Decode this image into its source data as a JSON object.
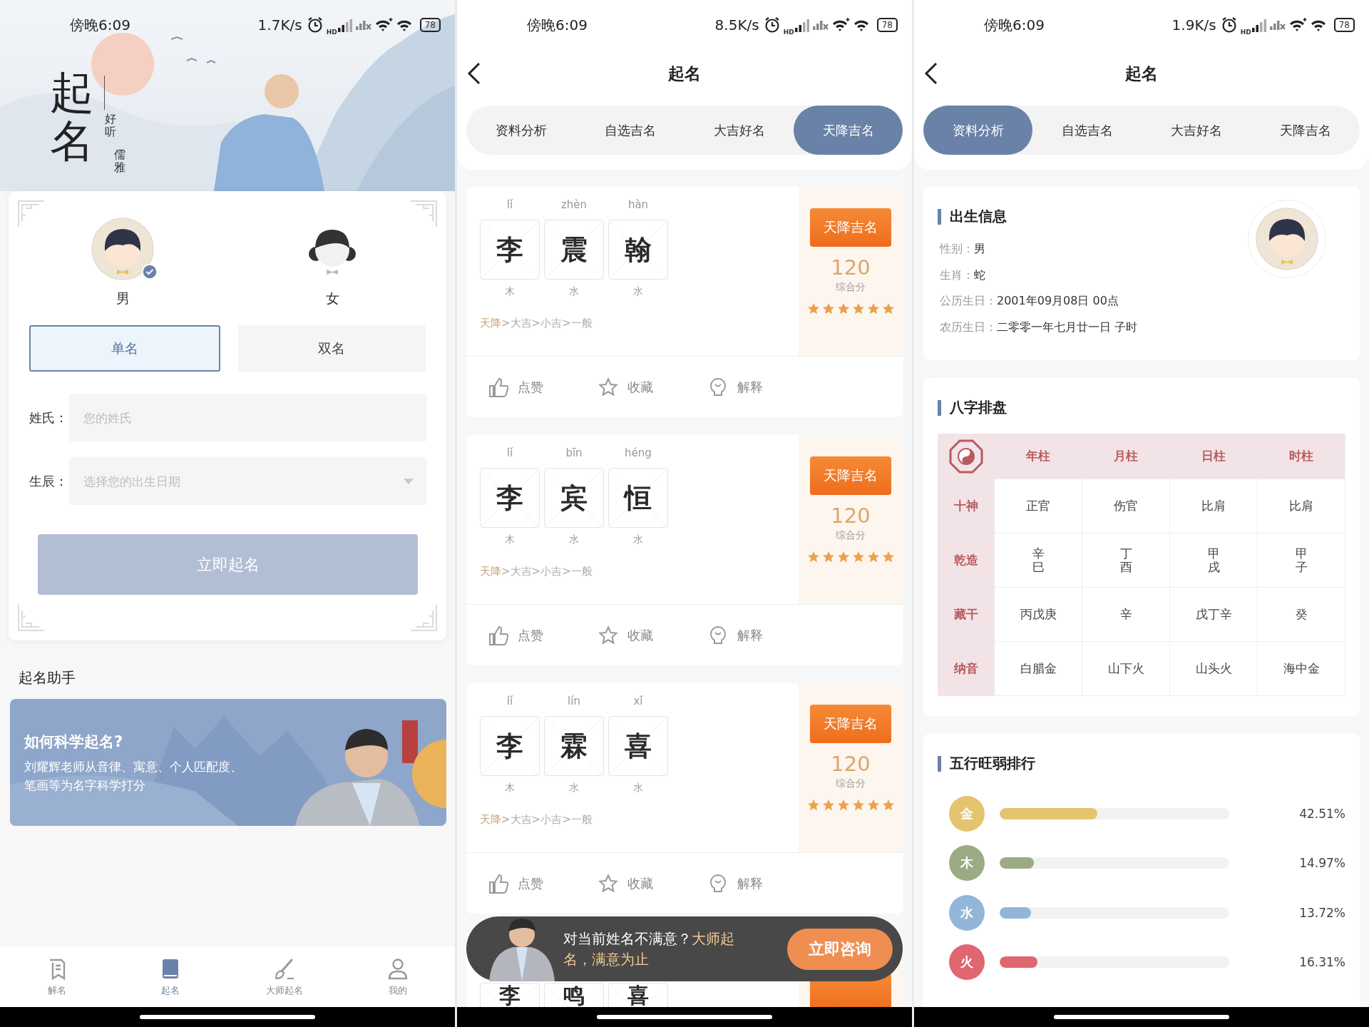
{
  "screens": [
    {
      "kind": "form",
      "status_bar": {
        "time": "傍晚6:09",
        "speed": "1.7K/s",
        "network": "HD",
        "battery": "78"
      },
      "hero": {
        "kind": "picture",
        "title": "起名",
        "taglines": [
          "好听",
          "儒雅"
        ]
      },
      "gender_options": [
        {
          "kind": "boy",
          "label": "男",
          "selected": true
        },
        {
          "kind": "girl",
          "label": "女",
          "selected": false
        }
      ],
      "name_types": [
        {
          "label": "单名",
          "selected": true
        },
        {
          "label": "双名",
          "selected": false
        }
      ],
      "fields": [
        {
          "kind": "text",
          "label": "姓氏：",
          "placeholder": "您的姓氏"
        },
        {
          "kind": "select",
          "label": "生辰：",
          "placeholder": "选择您的出生日期"
        }
      ],
      "submit": "立即起名",
      "section_title": "起名助手",
      "banner": {
        "title": "如何科学起名?",
        "text": "刘耀辉老师从音律、寓意、个人匹配度、笔画等为名字科学打分"
      },
      "tab_bar": [
        {
          "kind": "doc",
          "label": "解名",
          "selected": false
        },
        {
          "kind": "book",
          "label": "起名",
          "selected": true
        },
        {
          "kind": "brush",
          "label": "大师起名",
          "selected": false
        },
        {
          "kind": "person",
          "label": "我的",
          "selected": false
        }
      ]
    },
    {
      "kind": "names",
      "status_bar": {
        "time": "傍晚6:09",
        "speed": "8.5K/s",
        "network": "HD",
        "battery": "78"
      },
      "title": "起名",
      "tabs": [
        {
          "label": "资料分析",
          "selected": false
        },
        {
          "label": "自选吉名",
          "selected": false
        },
        {
          "label": "大吉好名",
          "selected": false
        },
        {
          "label": "天降吉名",
          "selected": true
        }
      ],
      "cards": [
        {
          "kind": "full",
          "chars": [
            {
              "pinyin": "lǐ",
              "char": "李",
              "element": "木"
            },
            {
              "pinyin": "zhèn",
              "char": "震",
              "element": "水"
            },
            {
              "pinyin": "hàn",
              "char": "翰",
              "element": "水"
            }
          ],
          "ranking_current": "天降",
          "ranking_rest": ">大吉>小吉>一般",
          "badge": "天降吉名",
          "score": "120",
          "score_label": "综合分",
          "stars": 6,
          "actions": [
            {
              "kind": "like",
              "label": "点赞"
            },
            {
              "kind": "star",
              "label": "收藏"
            },
            {
              "kind": "bulb",
              "label": "解释"
            }
          ]
        },
        {
          "kind": "full",
          "chars": [
            {
              "pinyin": "lǐ",
              "char": "李",
              "element": "木"
            },
            {
              "pinyin": "bīn",
              "char": "宾",
              "element": "水"
            },
            {
              "pinyin": "héng",
              "char": "恒",
              "element": "水"
            }
          ],
          "ranking_current": "天降",
          "ranking_rest": ">大吉>小吉>一般",
          "badge": "天降吉名",
          "score": "120",
          "score_label": "综合分",
          "stars": 6,
          "actions": [
            {
              "kind": "like",
              "label": "点赞"
            },
            {
              "kind": "star",
              "label": "收藏"
            },
            {
              "kind": "bulb",
              "label": "解释"
            }
          ]
        },
        {
          "kind": "full",
          "chars": [
            {
              "pinyin": "lǐ",
              "char": "李",
              "element": "木"
            },
            {
              "pinyin": "lín",
              "char": "霖",
              "element": "水"
            },
            {
              "pinyin": "xǐ",
              "char": "喜",
              "element": "水"
            }
          ],
          "ranking_current": "天降",
          "ranking_rest": ">大吉>小吉>一般",
          "badge": "天降吉名",
          "score": "120",
          "score_label": "综合分",
          "stars": 6,
          "actions": [
            {
              "kind": "like",
              "label": "点赞"
            },
            {
              "kind": "star",
              "label": "收藏"
            },
            {
              "kind": "bulb",
              "label": "解释"
            }
          ]
        },
        {
          "kind": "partial",
          "chars": [
            {
              "char": "李"
            },
            {
              "char": "鸣"
            },
            {
              "char": "喜"
            }
          ]
        }
      ],
      "promo": {
        "text": "对当前姓名不满意？",
        "highlight": "大师起名，满意为止",
        "button": "立即咨询"
      }
    },
    {
      "kind": "analysis",
      "status_bar": {
        "time": "傍晚6:09",
        "speed": "1.9K/s",
        "network": "HD",
        "battery": "78"
      },
      "title": "起名",
      "tabs": [
        {
          "label": "资料分析",
          "selected": true
        },
        {
          "label": "自选吉名",
          "selected": false
        },
        {
          "label": "大吉好名",
          "selected": false
        },
        {
          "label": "天降吉名",
          "selected": false
        }
      ],
      "birth_info": {
        "title": "出生信息",
        "rows": [
          {
            "label": "性别：",
            "value": "男"
          },
          {
            "label": "生肖：",
            "value": "蛇"
          },
          {
            "label": "公历生日：",
            "value": "2001年09月08日 00点"
          },
          {
            "label": "农历生日：",
            "value": "二零零一年七月廿一日 子时"
          }
        ]
      },
      "bazi": {
        "title": "八字排盘",
        "columns": [
          "年柱",
          "月柱",
          "日柱",
          "时柱"
        ],
        "rows": [
          {
            "kind": "plain",
            "label": "十神",
            "cells": [
              "正官",
              "伤官",
              "比肩",
              "比肩"
            ]
          },
          {
            "kind": "stacked",
            "label": "乾造",
            "cells": [
              "辛巳",
              "丁酉",
              "甲戌",
              "甲子"
            ]
          },
          {
            "kind": "plain",
            "label": "藏干",
            "cells": [
              "丙戊庚",
              "辛",
              "戊丁辛",
              "癸"
            ]
          },
          {
            "kind": "plain",
            "label": "纳音",
            "cells": [
              "白腊金",
              "山下火",
              "山头火",
              "海中金"
            ]
          }
        ]
      },
      "wuxing": {
        "title": "五行旺弱排行",
        "items": [
          {
            "label": "金",
            "color": "#e5c470",
            "level": 0.4251,
            "reading": "42.51%"
          },
          {
            "label": "木",
            "color": "#9bab84",
            "level": 0.1497,
            "reading": "14.97%"
          },
          {
            "label": "水",
            "color": "#92b6d8",
            "level": 0.1372,
            "reading": "13.72%"
          },
          {
            "label": "火",
            "color": "#e06670",
            "level": 0.1631,
            "reading": "16.31%"
          }
        ]
      }
    }
  ]
}
